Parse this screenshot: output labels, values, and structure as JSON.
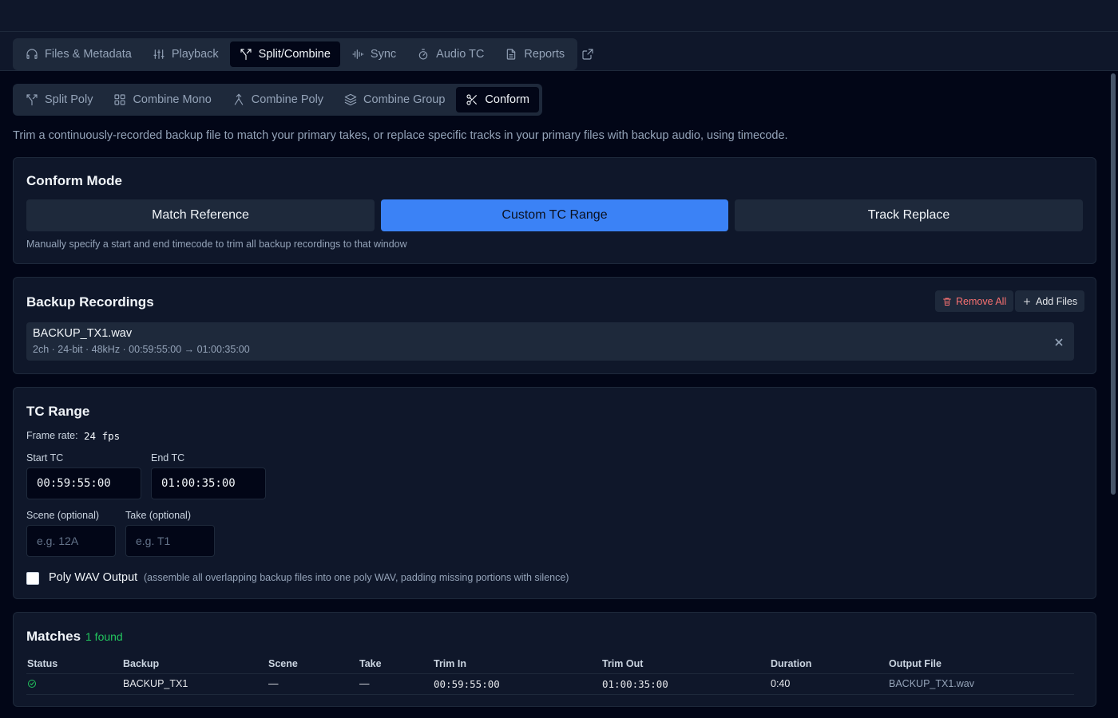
{
  "main_tabs": [
    {
      "label": "Files & Metadata",
      "icon": "headphones-icon",
      "active": false
    },
    {
      "label": "Playback",
      "icon": "sliders-icon",
      "active": false
    },
    {
      "label": "Split/Combine",
      "icon": "split-icon",
      "active": true
    },
    {
      "label": "Sync",
      "icon": "waveform-icon",
      "active": false
    },
    {
      "label": "Audio TC",
      "icon": "timer-icon",
      "active": false
    },
    {
      "label": "Reports",
      "icon": "document-icon",
      "active": false
    }
  ],
  "sub_tabs": [
    {
      "label": "Split Poly",
      "icon": "split-icon",
      "active": false
    },
    {
      "label": "Combine Mono",
      "icon": "grid-icon",
      "active": false
    },
    {
      "label": "Combine Poly",
      "icon": "merge-icon",
      "active": false
    },
    {
      "label": "Combine Group",
      "icon": "layers-icon",
      "active": false
    },
    {
      "label": "Conform",
      "icon": "scissors-icon",
      "active": true
    }
  ],
  "description": "Trim a continuously-recorded backup file to match your primary takes, or replace specific tracks in your primary files with backup audio, using timecode.",
  "conform_mode": {
    "title": "Conform Mode",
    "options": [
      "Match Reference",
      "Custom TC Range",
      "Track Replace"
    ],
    "selected": "Custom TC Range",
    "hint": "Manually specify a start and end timecode to trim all backup recordings to that window"
  },
  "backup": {
    "title": "Backup Recordings",
    "remove_all_label": "Remove All",
    "add_files_label": "Add Files",
    "files": [
      {
        "name": "BACKUP_TX1.wav",
        "meta": "2ch · 24-bit · 48kHz · 00:59:55:00 → 01:00:35:00"
      }
    ]
  },
  "tc_range": {
    "title": "TC Range",
    "frame_rate_label": "Frame rate:",
    "frame_rate_value": "24 fps",
    "start_label": "Start TC",
    "start_value": "00:59:55:00",
    "end_label": "End TC",
    "end_value": "01:00:35:00",
    "scene_label": "Scene (optional)",
    "scene_placeholder": "e.g. 12A",
    "take_label": "Take (optional)",
    "take_placeholder": "e.g. T1",
    "poly_label": "Poly WAV Output",
    "poly_note": "(assemble all overlapping backup files into one poly WAV, padding missing portions with silence)",
    "poly_checked": false
  },
  "matches": {
    "title": "Matches",
    "count_label": "1 found",
    "columns": [
      "Status",
      "Backup",
      "Scene",
      "Take",
      "Trim In",
      "Trim Out",
      "Duration",
      "Output File"
    ],
    "rows": [
      {
        "status": "check-circle-icon",
        "backup": "BACKUP_TX1",
        "scene": "—",
        "take": "—",
        "trim_in": "00:59:55:00",
        "trim_out": "01:00:35:00",
        "duration": "0:40",
        "output": "BACKUP_TX1.wav"
      }
    ]
  },
  "colors": {
    "accent": "#3b82f6",
    "danger": "#f87171",
    "success": "#22c55e",
    "background": "#020617",
    "card": "#0f172a"
  }
}
